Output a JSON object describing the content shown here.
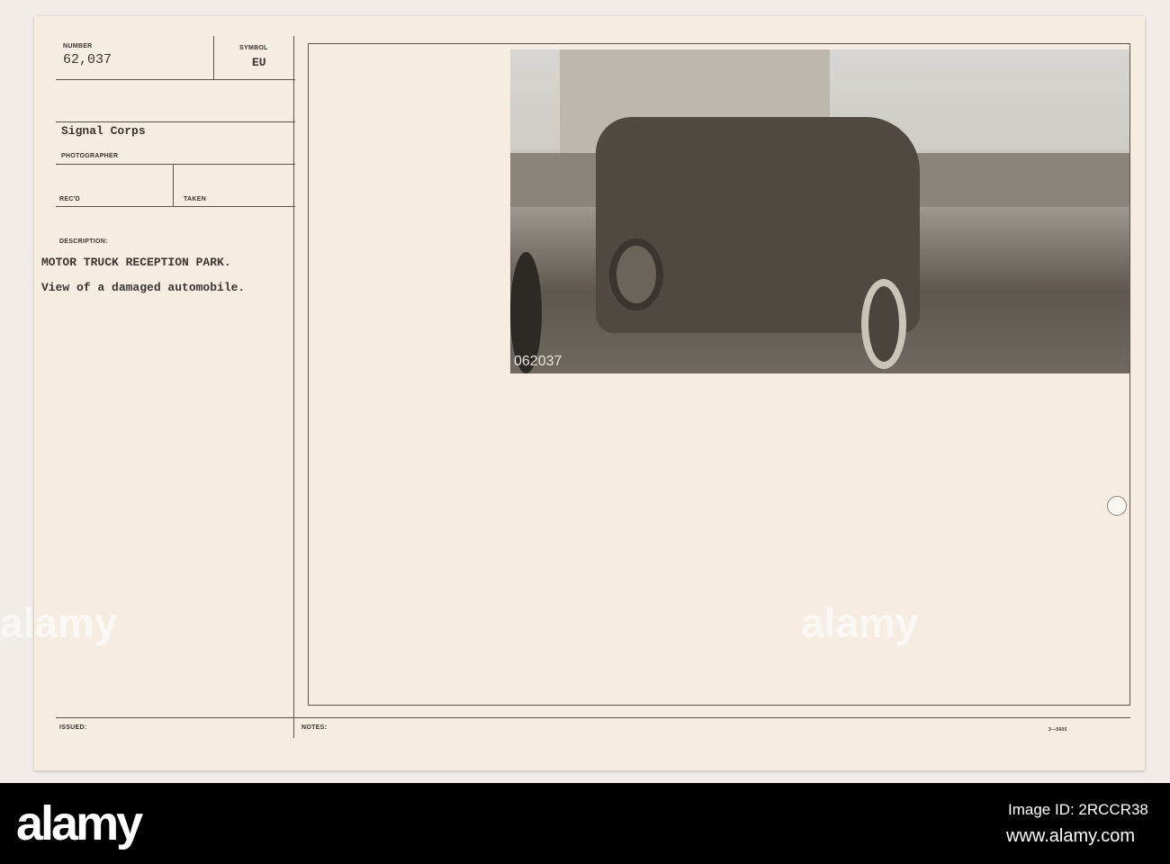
{
  "card": {
    "number_label": "NUMBER",
    "number": "62,037",
    "symbol_label": "SYMBOL",
    "symbol": "EU",
    "photographer": "Signal Corps",
    "photographer_label": "PHOTOGRAPHER",
    "recd_label": "REC'D",
    "taken_label": "TAKEN",
    "description_label": "DESCRIPTION:",
    "description_title": "MOTOR TRUCK RECEPTION PARK.",
    "description_text": "View of a damaged automobile.",
    "issued_label": "ISSUED:",
    "notes_label": "NOTES:",
    "form_number": "3—5605",
    "photo_number": "062037"
  },
  "watermark": {
    "logo": "alamy",
    "image_id": "Image ID: 2RCCR38",
    "url": "www.alamy.com"
  }
}
